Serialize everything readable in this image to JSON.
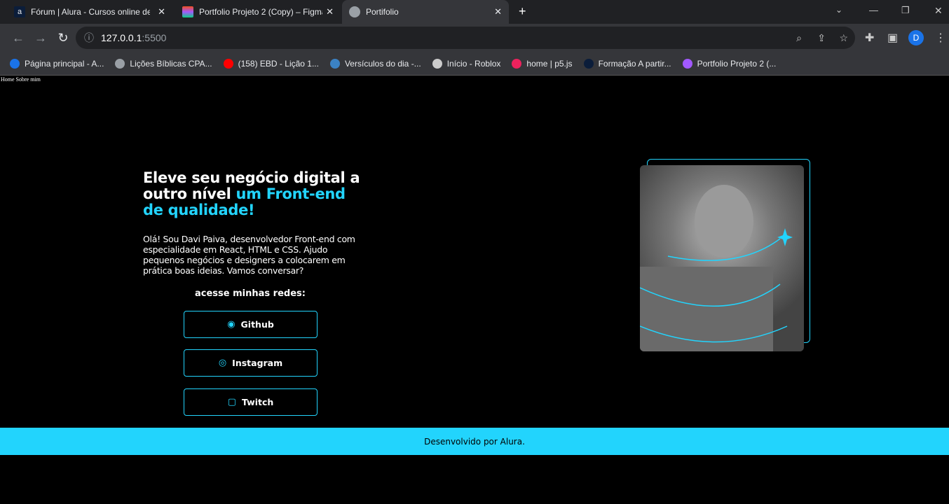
{
  "browser": {
    "tabs": [
      {
        "title": "Fórum | Alura - Cursos online de t",
        "icon": "alura-icon"
      },
      {
        "title": "Portfolio Projeto 2 (Copy) – Figma",
        "icon": "figma-icon"
      },
      {
        "title": "Portifolio",
        "icon": "globe-icon"
      }
    ],
    "new_tab": "+",
    "url_host": "127.0.0.1",
    "url_port": ":5500",
    "bookmarks": [
      {
        "label": "Página principal - A...",
        "color": "#1a73e8"
      },
      {
        "label": "Lições Bíblicas CPA...",
        "color": "#9aa0a6"
      },
      {
        "label": "(158) EBD - Lição 1...",
        "color": "#ff0000"
      },
      {
        "label": "Versículos do dia -...",
        "color": "#3b82c4"
      },
      {
        "label": "Início - Roblox",
        "color": "#cccccc"
      },
      {
        "label": "home | p5.js",
        "color": "#ed225d"
      },
      {
        "label": "Formação A partir...",
        "color": "#0b1d3a"
      },
      {
        "label": "Portfolio Projeto 2 (...",
        "color": "#a259ff"
      }
    ],
    "profile": "D"
  },
  "nav": {
    "text": "Home Sobre mim"
  },
  "hero": {
    "title_white": "Eleve seu negócio digital a outro nível ",
    "title_accent": "um Front-end de qualidade!",
    "intro": "Olá! Sou Davi Paiva, desenvolvedor Front-end com especialidade em React, HTML e CSS. Ajudo pequenos negócios e designers a colocarem em prática boas ideias. Vamos conversar?",
    "social_heading": "acesse minhas redes:",
    "buttons": [
      {
        "label": "Github",
        "icon": "github-icon"
      },
      {
        "label": "Instagram",
        "icon": "instagram-icon"
      },
      {
        "label": "Twitch",
        "icon": "twitch-icon"
      }
    ]
  },
  "footer": {
    "text": "Desenvolvido por Alura."
  },
  "colors": {
    "accent": "#22d4fd",
    "background": "#000000"
  }
}
